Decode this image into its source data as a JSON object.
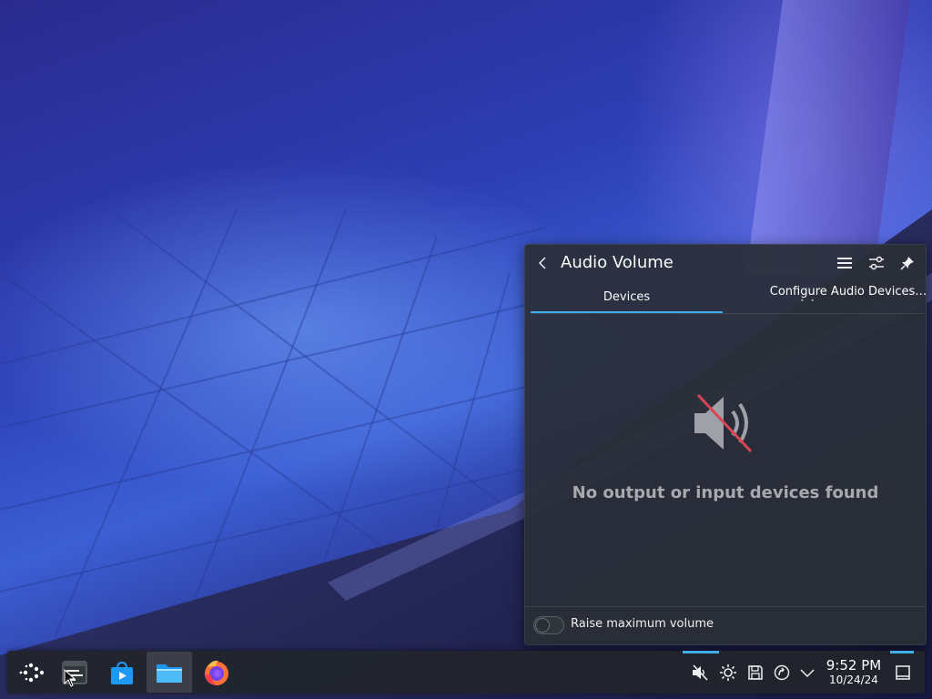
{
  "popup": {
    "title": "Audio Volume",
    "tabs": [
      {
        "label": "Devices",
        "active": true
      },
      {
        "label": "Configure Audio Devices…",
        "active": false
      }
    ],
    "empty_message": "No output or input devices found",
    "footer": {
      "toggle_label": "Raise maximum volume",
      "toggle_on": false
    }
  },
  "taskbar": {
    "launchers": [
      {
        "icon": "application-launcher-icon"
      },
      {
        "icon": "task-manager-icon"
      },
      {
        "icon": "discover-store-icon"
      },
      {
        "icon": "file-manager-icon",
        "active": true
      },
      {
        "icon": "firefox-icon"
      }
    ],
    "tray": [
      {
        "icon": "volume-muted-icon",
        "active": true
      },
      {
        "icon": "brightness-icon"
      },
      {
        "icon": "disks-icon"
      },
      {
        "icon": "update-icon"
      },
      {
        "icon": "chevron-up-icon"
      }
    ],
    "clock": {
      "time": "9:52 PM",
      "date": "10/24/24"
    },
    "show_desktop": {
      "icon": "peek-desktop-icon"
    }
  },
  "colors": {
    "accent": "#3daee9",
    "panel": "#2a2e37",
    "muted_slash": "#da4453"
  }
}
